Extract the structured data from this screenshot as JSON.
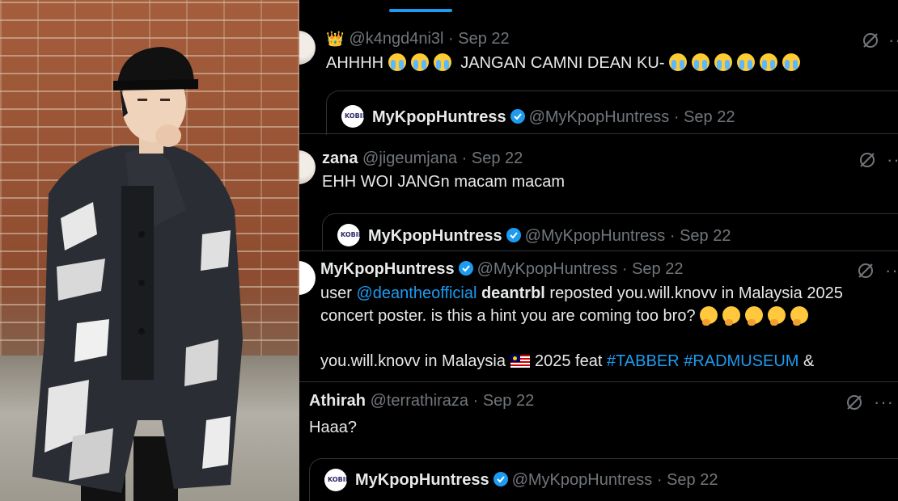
{
  "feed": {
    "tweets": [
      {
        "badge": "👑",
        "handle": "@k4ngd4ni3l",
        "dot": "·",
        "date": "Sep 22",
        "text_prefix": "AHHHH",
        "text_middle": "JANGAN CAMNI DEAN KU-",
        "crying_emoji_count_a": 3,
        "crying_emoji_count_b": 6,
        "quote": {
          "name": "MyKpopHuntress",
          "handle": "@MyKpopHuntress",
          "dot": "·",
          "date": "Sep 22",
          "logo": "KOBIE"
        }
      },
      {
        "name": "zana",
        "handle": "@jigeumjana",
        "dot": "·",
        "date": "Sep 22",
        "text": "EHH WOI JANGn macam macam",
        "quote": {
          "name": "MyKpopHuntress",
          "handle": "@MyKpopHuntress",
          "dot": "·",
          "date": "Sep 22",
          "logo": "KOBIE"
        }
      },
      {
        "name": "MyKpopHuntress",
        "handle": "@MyKpopHuntress",
        "dot": "·",
        "date": "Sep 22",
        "line1_a": "user ",
        "line1_mention": "@deantheofficial",
        "line1_bold": " deantrbl",
        "line1_b": " reposted you.will.knovv in Malaysia 2025",
        "line2": "concert poster. is this a hint you are coming too bro?",
        "line3_a": "you.will.knovv in Malaysia",
        "line3_b": "2025 feat ",
        "hashtag1": "#TABBER",
        "hashtag2": "#RADMUSEUM",
        "line3_c": " &"
      },
      {
        "name": "Athirah",
        "handle": "@terrathiraza",
        "dot": "·",
        "date": "Sep 22",
        "text": "Haaa?",
        "quote": {
          "name": "MyKpopHuntress",
          "handle": "@MyKpopHuntress",
          "dot": "·",
          "date": "Sep 22",
          "logo": "KOBIE"
        }
      }
    ],
    "more_label": "···"
  },
  "icons": {
    "grok": "grok-icon",
    "verified": "verified-badge-icon",
    "more": "more-options-icon"
  },
  "colors": {
    "accent": "#1d9bf0",
    "muted": "#71767b",
    "border": "#2f3336"
  }
}
